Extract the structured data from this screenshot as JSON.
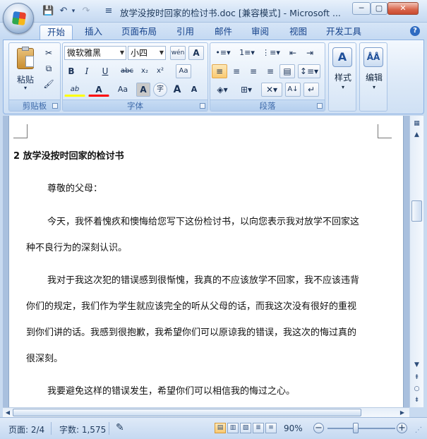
{
  "window": {
    "title": "放学没按时回家的检讨书.doc [兼容模式] - Microsoft ...",
    "min_glyph": "─",
    "max_glyph": "▢",
    "close_glyph": "✕"
  },
  "qat": {
    "save_icon": "💾",
    "undo_icon": "↶",
    "redo_icon": "↷",
    "dropdown_glyph": "▾",
    "customize_glyph": "≡"
  },
  "tabs": [
    "开始",
    "插入",
    "页面布局",
    "引用",
    "邮件",
    "审阅",
    "视图",
    "开发工具"
  ],
  "active_tab": "开始",
  "help_glyph": "?",
  "ribbon": {
    "clipboard": {
      "paste_label": "粘贴",
      "group_label": "剪贴板"
    },
    "font": {
      "font_name": "微软雅黑",
      "font_size": "小四",
      "phonetic_glyph": "wén",
      "char_border_glyph": "A",
      "bold": "B",
      "italic": "I",
      "underline": "U",
      "strike": "abc",
      "subscript": "x₂",
      "superscript": "x²",
      "clear_format": "Aa",
      "highlight": "ab",
      "font_color": "A",
      "change_case": "Aa",
      "char_shading": "A",
      "enclose_char": "字",
      "grow_font": "A",
      "shrink_font": "A",
      "group_label": "字体"
    },
    "paragraph": {
      "group_label": "段落",
      "sort_glyph": "A↓",
      "show_marks_glyph": "↵"
    },
    "styles": {
      "label": "样式",
      "icon_glyph": "A"
    },
    "editing": {
      "label": "编辑",
      "icon_glyph": "ÅÅ"
    }
  },
  "document": {
    "heading": "2 放学没按时回家的检讨书",
    "lines": [
      "尊敬的父母：",
      "今天，我怀着愧疚和懊悔给您写下这份检讨书，以向您表示我对放学不回家这",
      "种不良行为的深刻认识。",
      "我对于我这次犯的错误感到很惭愧，我真的不应该放学不回家，我不应该违背",
      "你们的规定，我们作为学生就应该完全的听从父母的话，而我这次没有很好的重视",
      "到你们讲的话。我感到很抱歉，我希望你们可以原谅我的错误，我这次的悔过真的",
      "很深刻。",
      "我要避免这样的错误发生，希望你们可以相信我的悔过之心。"
    ]
  },
  "status": {
    "page": "页面: 2/4",
    "words": "字数: 1,575",
    "zoom": "90%",
    "zoom_level_percent": 90
  },
  "colors": {
    "accent": "#15428b",
    "ribbon_bg": "#dbe8f7",
    "highlight_yellow": "#ffff00",
    "font_red": "#ff0000"
  }
}
